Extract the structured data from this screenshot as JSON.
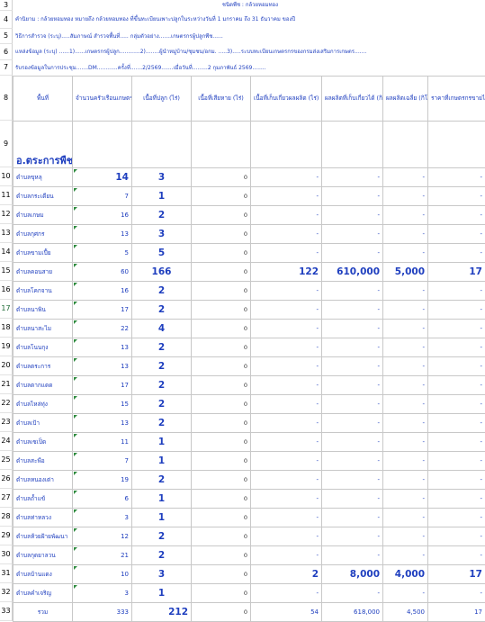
{
  "header_rows": {
    "title": "ชนิดพืช : กล้วยหอมทอง",
    "note": "คำนิยาม : กล้วยหอมทอง หมายถึง กล้วยหอมทอง ที่ขึ้นทะเบียนเพาะปลูกในระหว่างวันที่ 1 มกราคม ถึง 31 ธันวาคม ของปี",
    "method": "วิธีการสำรวจ (ระบุ).....สัมภาษณ์ สำรวจพื้นที่.....   กลุ่มตัวอย่าง.......เกษตรกรผู้ปลูกพืช......",
    "source": "แหล่งข้อมูล (ระบุ) ......1)......เกษตรกรผู้ปลูก............2)........ผู้นำหมู่บ้าน/ชุมชน/อกม. .....3).....ระบบทะเบียนเกษตรกรของกรมส่งเสริมการเกษตร.......",
    "meeting": "รับรองข้อมูลในการประชุม.......DM............ครั้งที่.......2/2569.......เมื่อวันที่.........2 กุมภาพันธ์ 2569........"
  },
  "row_numbers": [
    "3",
    "4",
    "5",
    "6",
    "7",
    "8",
    "9",
    "10",
    "11",
    "12",
    "13",
    "14",
    "15",
    "16",
    "17",
    "18",
    "19",
    "20",
    "21",
    "22",
    "23",
    "24",
    "25",
    "26",
    "27",
    "28",
    "29",
    "30",
    "31",
    "32",
    "33"
  ],
  "columns": [
    "พื้นที่",
    "จำนวนครัวเรือนเกษตรกร",
    "เนื้อที่ปลูก (ไร่)",
    "เนื้อที่เสียหาย (ไร่)",
    "เนื้อที่เก็บเกี่ยวผลผลิต (ไร่)",
    "ผลผลิตที่เก็บเกี่ยวได้ (กิโลกรัม)",
    "ผลผลิตเฉลี่ย (กิโลกรัม)",
    "ราคาที่เกษตรกรขายได้เฉลี่ย (บาท/กิโลกรัม)"
  ],
  "district": "อ.ตระการพืชผล",
  "rows": [
    {
      "area": "ตำบลขุหลุ",
      "households": "14",
      "planted": "3",
      "damaged": "0",
      "harvested_area": "-",
      "yield": "-",
      "avg_yield": "-",
      "price": "-",
      "hh_big": true
    },
    {
      "area": "ตำบลกระเดียน",
      "households": "7",
      "planted": "1",
      "damaged": "0",
      "harvested_area": "-",
      "yield": "-",
      "avg_yield": "-",
      "price": "-"
    },
    {
      "area": "ตำบลเกษม",
      "households": "16",
      "planted": "2",
      "damaged": "0",
      "harvested_area": "-",
      "yield": "-",
      "avg_yield": "-",
      "price": "-"
    },
    {
      "area": "ตำบลกุศกร",
      "households": "13",
      "planted": "3",
      "damaged": "0",
      "harvested_area": "-",
      "yield": "-",
      "avg_yield": "-",
      "price": "-"
    },
    {
      "area": "ตำบลขามเปี้ย",
      "households": "5",
      "planted": "5",
      "damaged": "0",
      "harvested_area": "-",
      "yield": "-",
      "avg_yield": "-",
      "price": "-"
    },
    {
      "area": "ตำบลคอนสาย",
      "households": "60",
      "planted": "166",
      "damaged": "0",
      "harvested_area": "122",
      "yield": "610,000",
      "avg_yield": "5,000",
      "price": "17",
      "big_values": true
    },
    {
      "area": "ตำบลโคกจาน",
      "households": "16",
      "planted": "2",
      "damaged": "0",
      "harvested_area": "-",
      "yield": "-",
      "avg_yield": "-",
      "price": "-"
    },
    {
      "area": "ตำบลนาพิน",
      "households": "17",
      "planted": "2",
      "damaged": "0",
      "harvested_area": "-",
      "yield": "-",
      "avg_yield": "-",
      "price": "-"
    },
    {
      "area": "ตำบลนาสะไม",
      "households": "22",
      "planted": "4",
      "damaged": "0",
      "harvested_area": "-",
      "yield": "-",
      "avg_yield": "-",
      "price": "-"
    },
    {
      "area": "ตำบลโนนกุง",
      "households": "13",
      "planted": "2",
      "damaged": "0",
      "harvested_area": "-",
      "yield": "-",
      "avg_yield": "-",
      "price": "-"
    },
    {
      "area": "ตำบลตระการ",
      "households": "13",
      "planted": "2",
      "damaged": "0",
      "harvested_area": "-",
      "yield": "-",
      "avg_yield": "-",
      "price": "-"
    },
    {
      "area": "ตำบลตากแดด",
      "households": "17",
      "planted": "2",
      "damaged": "0",
      "harvested_area": "-",
      "yield": "-",
      "avg_yield": "-",
      "price": "-"
    },
    {
      "area": "ตำบลไหล่ทุ่ง",
      "households": "15",
      "planted": "2",
      "damaged": "0",
      "harvested_area": "-",
      "yield": "-",
      "avg_yield": "-",
      "price": "-"
    },
    {
      "area": "ตำบลเป้า",
      "households": "13",
      "planted": "2",
      "damaged": "0",
      "harvested_area": "-",
      "yield": "-",
      "avg_yield": "-",
      "price": "-"
    },
    {
      "area": "ตำบลเซเป็ด",
      "households": "11",
      "planted": "1",
      "damaged": "0",
      "harvested_area": "-",
      "yield": "-",
      "avg_yield": "-",
      "price": "-"
    },
    {
      "area": "ตำบลสะพือ",
      "households": "7",
      "planted": "1",
      "damaged": "0",
      "harvested_area": "-",
      "yield": "-",
      "avg_yield": "-",
      "price": "-"
    },
    {
      "area": "ตำบลหนองเต่า",
      "households": "19",
      "planted": "2",
      "damaged": "0",
      "harvested_area": "-",
      "yield": "-",
      "avg_yield": "-",
      "price": "-"
    },
    {
      "area": "ตำบลถ้ำแข้",
      "households": "6",
      "planted": "1",
      "damaged": "0",
      "harvested_area": "-",
      "yield": "-",
      "avg_yield": "-",
      "price": "-"
    },
    {
      "area": "ตำบลท่าหลวง",
      "households": "3",
      "planted": "1",
      "damaged": "0",
      "harvested_area": "-",
      "yield": "-",
      "avg_yield": "-",
      "price": "-"
    },
    {
      "area": "ตำบลห้วยฝ้ายพัฒนา",
      "households": "12",
      "planted": "2",
      "damaged": "0",
      "harvested_area": "-",
      "yield": "-",
      "avg_yield": "-",
      "price": "-"
    },
    {
      "area": "ตำบลกุดยาลวน",
      "households": "21",
      "planted": "2",
      "damaged": "0",
      "harvested_area": "-",
      "yield": "-",
      "avg_yield": "-",
      "price": "-"
    },
    {
      "area": "ตำบลบ้านแดง",
      "households": "10",
      "planted": "3",
      "damaged": "0",
      "harvested_area": "2",
      "yield": "8,000",
      "avg_yield": "4,000",
      "price": "17",
      "big_values": true
    },
    {
      "area": "ตำบลคำเจริญ",
      "households": "3",
      "planted": "1",
      "damaged": "0",
      "harvested_area": "-",
      "yield": "-",
      "avg_yield": "-",
      "price": "-"
    }
  ],
  "total": {
    "area": "รวม",
    "households": "333",
    "planted": "212",
    "damaged": "0",
    "harvested_area": "54",
    "yield": "618,000",
    "avg_yield": "4,500",
    "price": "17"
  },
  "colors": {
    "text": "#1f3fbf",
    "grid": "#c8c8c8",
    "indicator": "#2e8b3e",
    "selected_row_label": "#1e6b35"
  }
}
